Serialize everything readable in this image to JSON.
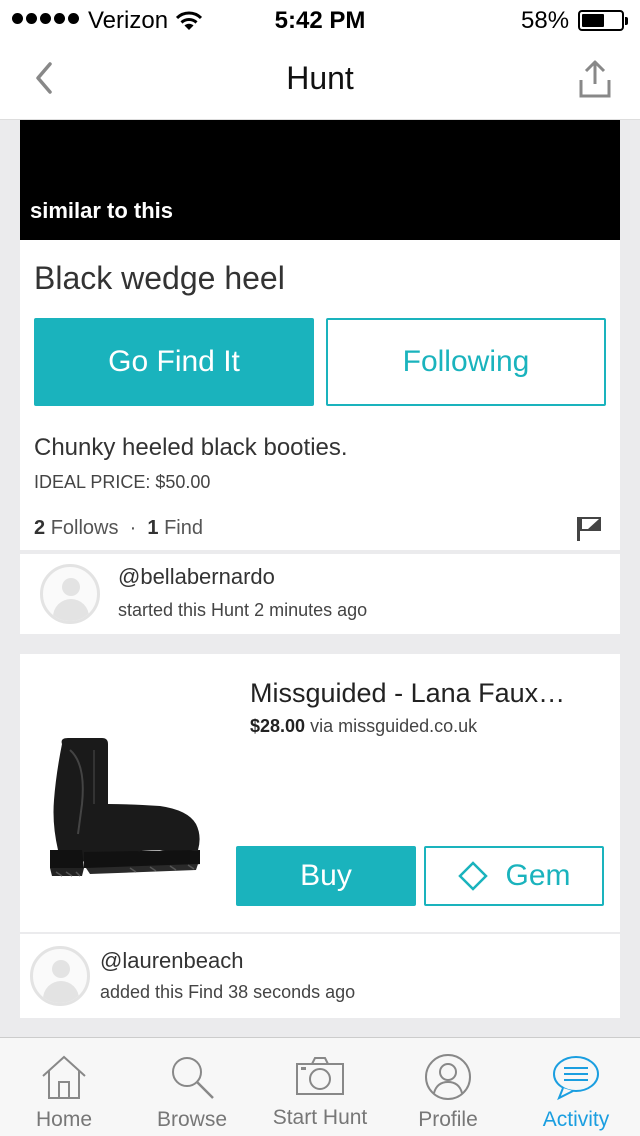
{
  "status_bar": {
    "carrier": "Verizon",
    "time": "5:42 PM",
    "battery_percent": "58%",
    "battery_level": 0.58
  },
  "nav": {
    "title": "Hunt",
    "back_icon": "chevron-left-icon",
    "share_icon": "share-icon"
  },
  "hunt": {
    "banner_text": "similar to this",
    "title": "Black wedge heel",
    "primary_button": "Go Find It",
    "secondary_button": "Following",
    "description": "Chunky heeled black booties.",
    "ideal_price": "IDEAL PRICE: $50.00",
    "follows_count": "2",
    "follows_label": "Follows",
    "separator": "·",
    "finds_count": "1",
    "finds_label": "Find"
  },
  "hunt_creator": {
    "username": "@bellabernardo",
    "action": "started this Hunt 2 minutes ago"
  },
  "find": {
    "title": "Missguided - Lana Faux…",
    "price": "$28.00",
    "via": "via missguided.co.uk",
    "buy_button": "Buy",
    "gem_button": "Gem",
    "finder": {
      "username": "@laurenbeach",
      "action": "added this Find 38 seconds ago"
    }
  },
  "tabs": [
    {
      "label": "Home",
      "icon": "home-icon"
    },
    {
      "label": "Browse",
      "icon": "search-icon"
    },
    {
      "label": "Start Hunt",
      "icon": "camera-icon"
    },
    {
      "label": "Profile",
      "icon": "profile-icon"
    },
    {
      "label": "Activity",
      "icon": "chat-bubble-icon",
      "active": true
    }
  ],
  "colors": {
    "accent": "#1ab3bd",
    "active_tab": "#1a9ee0",
    "background": "#ebebed"
  }
}
